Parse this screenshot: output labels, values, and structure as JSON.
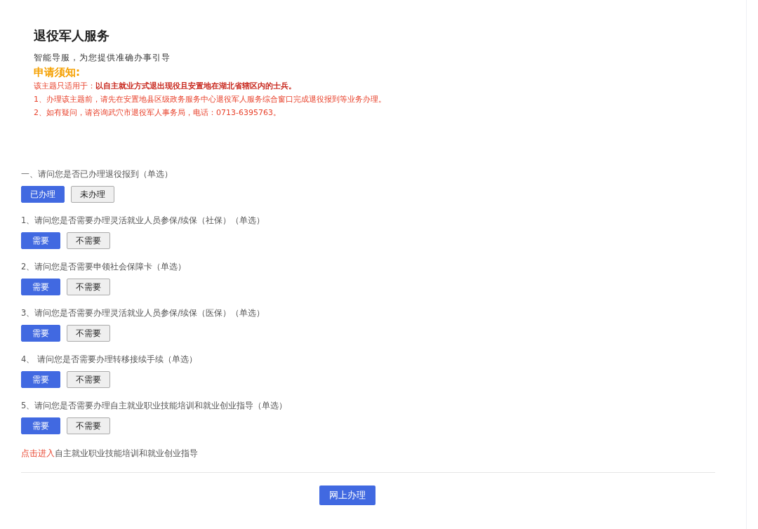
{
  "header": {
    "title": "退役军人服务",
    "subtitle": "智能导服，为您提供准确办事引导"
  },
  "notice": {
    "heading": "申请须知:",
    "lines": [
      "该主题只适用于：**以自主就业方式退出现役且安置地在湖北省辖区内的士兵。**",
      "1、办理该主题前，请先在安置地县区级政务服务中心退役军人服务综合窗口完成退役报到等业务办理。",
      "2、如有疑问，请咨询武穴市退役军人事务局，电话：0713-6395763。"
    ]
  },
  "questions": [
    {
      "label": "一、请问您是否已办理退役报到（单选）",
      "options": [
        {
          "label": "已办理",
          "selected": true
        },
        {
          "label": "未办理",
          "selected": false
        }
      ]
    },
    {
      "label": "1、请问您是否需要办理灵活就业人员参保/续保（社保）（单选）",
      "options": [
        {
          "label": "需要",
          "selected": true
        },
        {
          "label": "不需要",
          "selected": false
        }
      ]
    },
    {
      "label": "2、请问您是否需要申领社会保障卡（单选）",
      "options": [
        {
          "label": "需要",
          "selected": true
        },
        {
          "label": "不需要",
          "selected": false
        }
      ]
    },
    {
      "label": "3、请问您是否需要办理灵活就业人员参保/续保（医保）（单选）",
      "options": [
        {
          "label": "需要",
          "selected": true
        },
        {
          "label": "不需要",
          "selected": false
        }
      ]
    },
    {
      "label": "4、 请问您是否需要办理转移接续手续（单选）",
      "options": [
        {
          "label": "需要",
          "selected": true
        },
        {
          "label": "不需要",
          "selected": false
        }
      ]
    },
    {
      "label": "5、请问您是否需要办理自主就业职业技能培训和就业创业指导（单选）",
      "options": [
        {
          "label": "需要",
          "selected": true
        },
        {
          "label": "不需要",
          "selected": false
        }
      ]
    }
  ],
  "guide": {
    "link": "点击进入",
    "text": "自主就业职业技能培训和就业创业指导"
  },
  "submit": "网上办理"
}
